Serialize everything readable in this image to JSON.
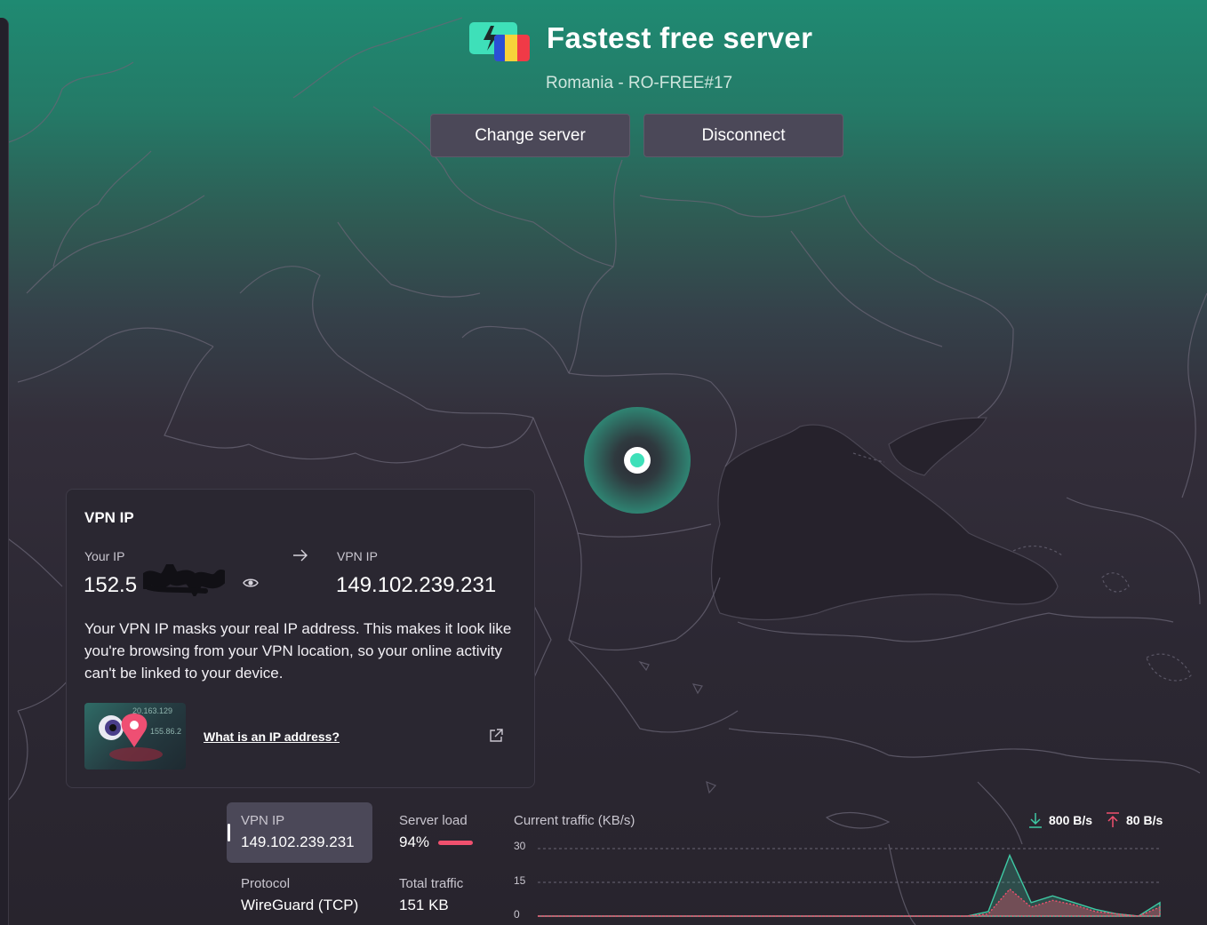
{
  "header": {
    "title": "Fastest free server",
    "subtitle": "Romania - RO-FREE#17",
    "change_server_label": "Change server",
    "disconnect_label": "Disconnect"
  },
  "ip_card": {
    "title": "VPN IP",
    "your_ip_label": "Your IP",
    "your_ip_value": "152.5",
    "vpn_ip_label": "VPN IP",
    "vpn_ip_value": "149.102.239.231",
    "description": "Your VPN IP masks your real IP address. This makes it look like you're browsing from your VPN location, so your online activity can't be linked to your device.",
    "thumb_text_1": "20.163.129",
    "thumb_text_2": "155.86.2",
    "link_label": "What is an IP address?"
  },
  "stats": {
    "vpn_ip_label": "VPN IP",
    "vpn_ip_value": "149.102.239.231",
    "server_load_label": "Server load",
    "server_load_value": "94%",
    "server_load_fraction": 0.94,
    "protocol_label": "Protocol",
    "protocol_value": "WireGuard (TCP)",
    "total_traffic_label": "Total traffic",
    "total_traffic_value": "151 KB"
  },
  "chart_data": {
    "type": "area",
    "title": "Current traffic (KB/s)",
    "legend": [
      {
        "name": "800 B/s",
        "direction": "download",
        "color": "#3ec9a4"
      },
      {
        "name": "80 B/s",
        "direction": "upload",
        "color": "#f0506e"
      }
    ],
    "yticks": [
      "30",
      "15",
      "0"
    ],
    "ylim": [
      0,
      30
    ],
    "x": [
      0,
      1,
      2,
      3,
      4,
      5,
      6,
      7,
      8,
      9,
      10,
      11,
      12,
      13,
      14,
      15,
      16,
      17,
      18,
      19,
      20,
      21,
      22,
      23,
      24,
      25,
      26,
      27,
      28,
      29
    ],
    "series": [
      {
        "color": "#3ec9a4",
        "values": [
          0,
          0,
          0,
          0,
          0,
          0,
          0,
          0,
          0,
          0,
          0,
          0,
          0,
          0,
          0,
          0,
          0,
          0,
          0,
          0,
          0,
          2,
          27,
          6,
          9,
          6,
          3,
          1,
          0,
          6
        ]
      },
      {
        "color": "#f0506e",
        "values": [
          0,
          0,
          0,
          0,
          0,
          0,
          0,
          0,
          0,
          0,
          0,
          0,
          0,
          0,
          0,
          0,
          0,
          0,
          0,
          0,
          0,
          1,
          12,
          4,
          7,
          5,
          2,
          1,
          0,
          4
        ]
      }
    ]
  }
}
